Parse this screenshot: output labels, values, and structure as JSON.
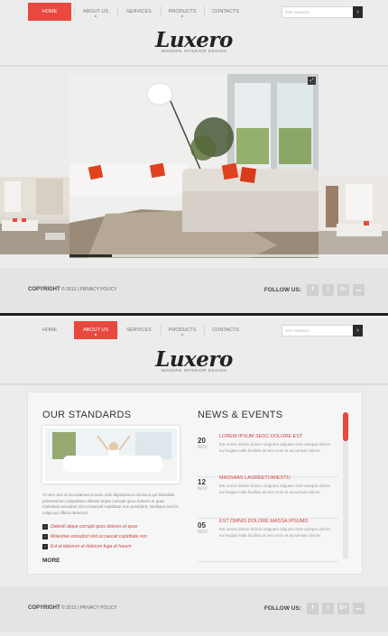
{
  "nav": {
    "items": [
      {
        "label": "HOME"
      },
      {
        "label": "ABOUT US"
      },
      {
        "label": "SERVICES"
      },
      {
        "label": "PRODUCTS"
      },
      {
        "label": "CONTACTS"
      }
    ],
    "search_placeholder": "SITE SEARCH",
    "search_button": "›"
  },
  "logo": {
    "name": "Luxero",
    "tagline": "MODERN INTERIOR DESIGN"
  },
  "slider": {
    "progress": 0.17,
    "fullscreen_icon": "⤢"
  },
  "footer": {
    "copyright": "COPYRIGHT",
    "year_text": "© 2013 | PRIVACY POLICY",
    "follow": "FOLLOW US:",
    "social": [
      "f",
      "t",
      "G+",
      "rss"
    ]
  },
  "about": {
    "standards_title": "OUR STANDARDS",
    "standards_text": "At vero eos et accusamus et iusto odio dignissimos ducimus qui blanditiis praesentium voluptatum deleniti atque corrupti quos dolores et quas molestias excepturi sint occaecati cupiditate non provident, similique sunt in culpa qui officia deserunt.",
    "bullets": [
      "Deleniti atque corrupti quos dolores et quas",
      "Molestias excepturi sint occaecati cupiditate non",
      "Est et laborum et dolorum fuga et harum"
    ],
    "more": "MORE",
    "news_title": "NEWS & EVENTS",
    "news": [
      {
        "day": "20",
        "month": "NOV",
        "title": "LOREM IPSUM SEDC DOLORE EST",
        "text": "Est omnis dolore dolore magnam aliquam erat volutpat dolore eu feugiat nulla facilisis at vero eros et accumsan dolore."
      },
      {
        "day": "12",
        "month": "NOV",
        "title": "MASSAAS LAGREETUMIESTU",
        "text": "Est omnis dolore dolore magnam aliquam erat volutpat dolore eu feugiat nulla facilisis at vero eros et accumsan dolore."
      },
      {
        "day": "05",
        "month": "NOV",
        "title": "EST OMNIS DOLORE MASSA IPSUMD",
        "text": "Est omnis dolore dolore magnam aliquam erat volutpat dolore eu feugiat nulla facilisis at vero eros et accumsan dolore."
      }
    ]
  },
  "colors": {
    "accent": "#e8483e",
    "dark": "#2b2b2b",
    "background": "#ececec"
  }
}
